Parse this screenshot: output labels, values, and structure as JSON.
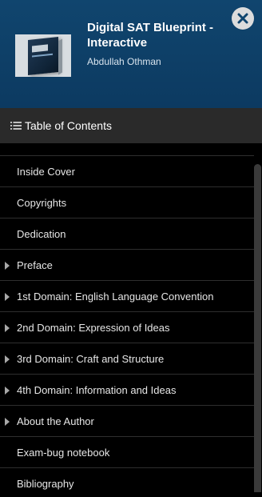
{
  "book": {
    "title": "Digital SAT Blueprint - Interactive",
    "author": "Abdullah Othman"
  },
  "close_icon": "close-icon",
  "toc": {
    "header_label": "Table of Contents",
    "header_icon": "list-icon",
    "items": [
      {
        "label": "Inside Cover",
        "expandable": false
      },
      {
        "label": "Copyrights",
        "expandable": false
      },
      {
        "label": "Dedication",
        "expandable": false
      },
      {
        "label": "Preface",
        "expandable": true
      },
      {
        "label": "1st Domain: English Language Convention",
        "expandable": true
      },
      {
        "label": "2nd Domain: Expression of Ideas",
        "expandable": true
      },
      {
        "label": "3rd Domain: Craft and Structure",
        "expandable": true
      },
      {
        "label": "4th Domain: Information and Ideas",
        "expandable": true
      },
      {
        "label": "About the Author",
        "expandable": true
      },
      {
        "label": "Exam-bug notebook",
        "expandable": false
      },
      {
        "label": "Bibliography",
        "expandable": false
      }
    ]
  },
  "colors": {
    "header_bg": "#0c3a61",
    "toc_header_bg": "#2a2a2a",
    "list_bg": "#000000",
    "text": "#e6e6e6"
  }
}
